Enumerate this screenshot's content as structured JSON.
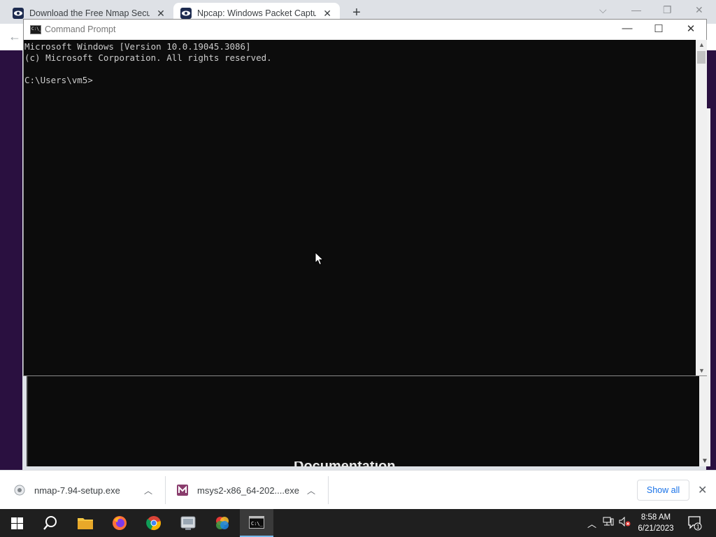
{
  "browser": {
    "tabs": [
      {
        "title": "Download the Free Nmap Securi",
        "active": false
      },
      {
        "title": "Npcap: Windows Packet Capture",
        "active": true
      }
    ],
    "new_tab_label": "+",
    "page_heading_peek": "Documentation"
  },
  "cmd_window": {
    "title": "Command Prompt",
    "lines": [
      "Microsoft Windows [Version 10.0.19045.3086]",
      "(c) Microsoft Corporation. All rights reserved.",
      "",
      "C:\\Users\\vm5>"
    ]
  },
  "downloads": {
    "items": [
      {
        "filename": "nmap-7.94-setup.exe",
        "icon": "installer-icon"
      },
      {
        "filename": "msys2-x86_64-202....exe",
        "icon": "msys2-icon"
      }
    ],
    "show_all_label": "Show all"
  },
  "taskbar": {
    "apps": [
      "start-icon",
      "search-icon",
      "file-explorer-icon",
      "firefox-icon",
      "chrome-icon",
      "app-icon",
      "color-app-icon",
      "command-prompt-icon"
    ],
    "time": "8:58 AM",
    "date": "6/21/2023",
    "notification_count": "1"
  }
}
